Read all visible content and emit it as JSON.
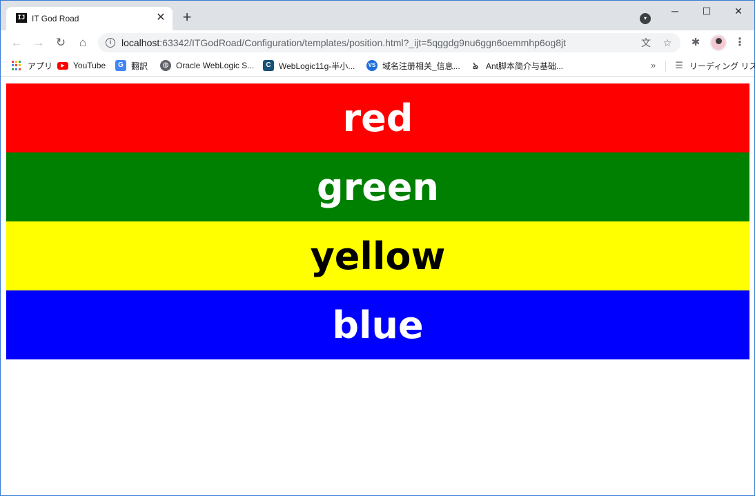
{
  "tab": {
    "title": "IT God Road",
    "favicon_text": "IJ",
    "close_glyph": "✕",
    "new_tab_glyph": "+"
  },
  "window_controls": {
    "minimize": "─",
    "maximize": "☐",
    "close": "✕"
  },
  "toolbar": {
    "back_glyph": "←",
    "forward_glyph": "→",
    "reload_glyph": "↻",
    "home_glyph": "⌂",
    "url_host": "localhost",
    "url_rest": ":63342/ITGodRoad/Configuration/templates/position.html?_ijt=5qggdg9nu6ggn6oemmhp6og8jt",
    "translate_glyph": "文",
    "star_glyph": "☆",
    "extensions_glyph": "✱",
    "menu_glyph": "⋮"
  },
  "bookmarks": {
    "items": [
      {
        "label": "アプリ",
        "icon": "apps-grid-icon"
      },
      {
        "label": "YouTube",
        "icon": "youtube-icon",
        "color": "#ff0000"
      },
      {
        "label": "翻訳",
        "icon": "translate-icon",
        "color": "#4285f4"
      },
      {
        "label": "Oracle WebLogic S...",
        "icon": "globe-icon",
        "color": "#5f6368"
      },
      {
        "label": "WebLogic11g-半小...",
        "icon": "cnblogs-icon",
        "color": "#1a5276"
      },
      {
        "label": "域名注册相关_信息...",
        "icon": "vs-icon",
        "color": "#1e6fd9"
      },
      {
        "label": "Ant脚本简介与基础...",
        "icon": "ant-icon",
        "color": "#333333"
      }
    ],
    "more_glyph": "»",
    "reading_list": "リーディング リスト"
  },
  "bands": [
    {
      "label": "red",
      "bg": "#ff0000",
      "fg": "#ffffff"
    },
    {
      "label": "green",
      "bg": "#008000",
      "fg": "#ffffff"
    },
    {
      "label": "yellow",
      "bg": "#ffff00",
      "fg": "#000000"
    },
    {
      "label": "blue",
      "bg": "#0000ff",
      "fg": "#ffffff"
    }
  ]
}
